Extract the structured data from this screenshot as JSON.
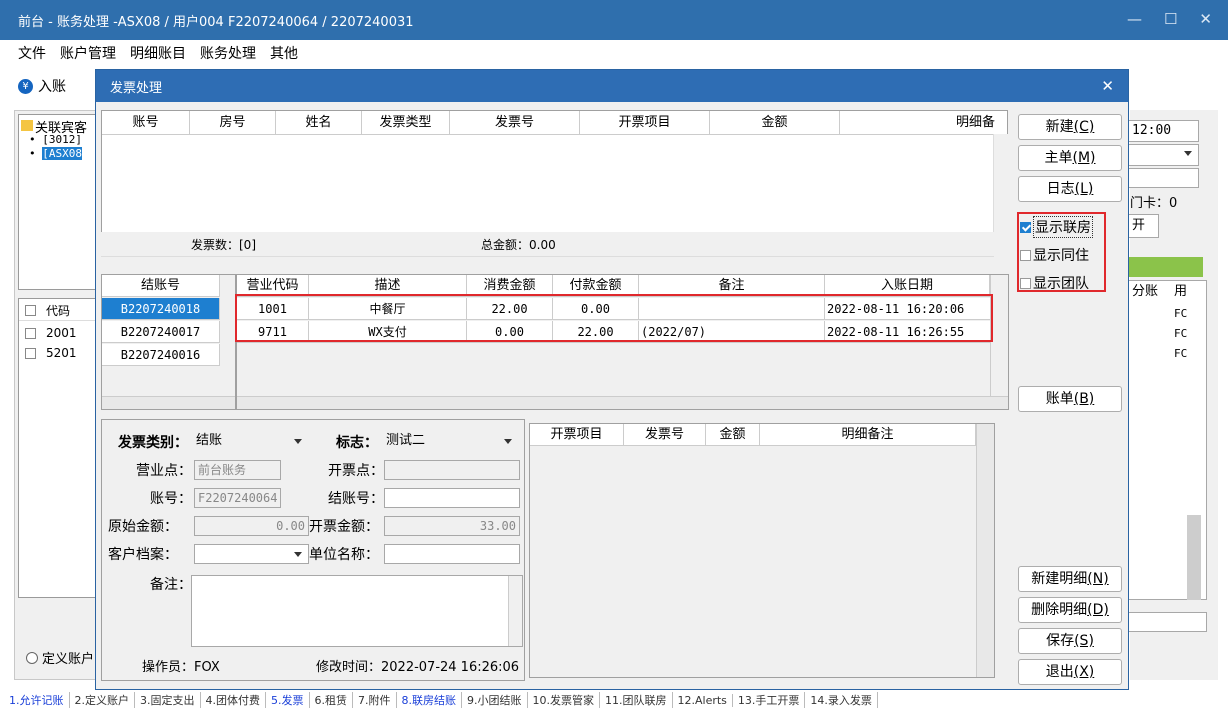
{
  "app": {
    "title": "前台 - 账务处理 -ASX08 / 用户004 F2207240064 / 2207240031",
    "menu": [
      "文件",
      "账户管理",
      "明细账目",
      "账务处理",
      "其他"
    ],
    "entry_button": "入账",
    "entry_icon_glyph": "¥"
  },
  "background": {
    "tree_root": "关联宾客",
    "tree_item1": "[3012]",
    "tree_item2": "[ASX08",
    "code_header": "代码",
    "codes": [
      "2001",
      "5201"
    ],
    "radio_label": "定义账户",
    "time": "12:00",
    "card_label": "门卡：0",
    "open_button": "开",
    "table_headers": [
      "分账",
      "用"
    ],
    "fc": [
      "FC",
      "FC",
      "FC"
    ]
  },
  "dialog": {
    "title": "发票处理",
    "invoice_grid": {
      "columns": [
        "账号",
        "房号",
        "姓名",
        "发票类型",
        "发票号",
        "开票项目",
        "金额",
        "明细备"
      ],
      "footer_count_label": "发票数：[0]",
      "footer_total_label": "总金额：0.00"
    },
    "checkout_list": {
      "header": "结账号",
      "items": [
        "B2207240018",
        "B2207240017",
        "B2207240016"
      ],
      "selected": "B2207240018"
    },
    "detail_grid": {
      "columns": [
        "营业代码",
        "描述",
        "消费金额",
        "付款金额",
        "备注",
        "入账日期"
      ],
      "rows": [
        {
          "code": "1001",
          "desc": "中餐厅",
          "charge": "22.00",
          "payment": "0.00",
          "remark": "",
          "date": "2022-08-11 16:20:06"
        },
        {
          "code": "9711",
          "desc": "WX支付",
          "charge": "0.00",
          "payment": "22.00",
          "remark": "(2022/07)",
          "date": "2022-08-11 16:26:55"
        }
      ]
    },
    "form": {
      "category_label": "发票类别：",
      "category_value": "结账",
      "flag_label": "标志：",
      "flag_value": "测试二",
      "outlet_label": "营业点：",
      "outlet_value": "前台账务",
      "invoice_point_label": "开票点：",
      "invoice_point_value": "",
      "account_label": "账号：",
      "account_value": "F2207240064",
      "checkout_no_label": "结账号：",
      "checkout_no_value": "",
      "orig_amount_label": "原始金额：",
      "orig_amount_value": "0.00",
      "invoice_amount_label": "开票金额：",
      "invoice_amount_value": "33.00",
      "customer_label": "客户档案：",
      "customer_value": "",
      "company_label": "单位名称：",
      "company_value": "",
      "remark_label": "备注：",
      "operator_text": "操作员：FOX",
      "modified_text": "修改时间：2022-07-24 16:26:06"
    },
    "item_grid": {
      "columns": [
        "开票项目",
        "发票号",
        "金额",
        "明细备注"
      ]
    },
    "buttons": {
      "new": "新建",
      "new_key": "(C)",
      "master": "主单",
      "master_key": "(M)",
      "log": "日志",
      "log_key": "(L)",
      "bill": "账单",
      "bill_key": "(B)",
      "new_detail": "新建明细",
      "new_detail_key": "(N)",
      "delete_detail": "删除明细",
      "delete_detail_key": "(D)",
      "save": "保存",
      "save_key": "(S)",
      "exit": "退出",
      "exit_key": "(X)"
    },
    "checkboxes": [
      {
        "label": "显示联房",
        "checked": true
      },
      {
        "label": "显示同住",
        "checked": false
      },
      {
        "label": "显示团队",
        "checked": false
      }
    ]
  },
  "statusbar": [
    {
      "label": "1.允许记账",
      "blue": true
    },
    {
      "label": "2.定义账户",
      "blue": false
    },
    {
      "label": "3.固定支出",
      "blue": false
    },
    {
      "label": "4.团体付费",
      "blue": false
    },
    {
      "label": "5.发票",
      "blue": true
    },
    {
      "label": "6.租赁",
      "blue": false
    },
    {
      "label": "7.附件",
      "blue": false
    },
    {
      "label": "8.联房结账",
      "blue": true
    },
    {
      "label": "9.小团结账",
      "blue": false
    },
    {
      "label": "10.发票管家",
      "blue": false
    },
    {
      "label": "11.团队联房",
      "blue": false
    },
    {
      "label": "12.Alerts",
      "blue": false
    },
    {
      "label": "13.手工开票",
      "blue": false
    },
    {
      "label": "14.录入发票",
      "blue": false
    }
  ],
  "colors": {
    "titlebar": "#2f6fad",
    "dialog_title": "#2e6db4",
    "selection": "#1e7fd0",
    "highlight": "#e0282c",
    "accent_green": "#8bc34a"
  }
}
